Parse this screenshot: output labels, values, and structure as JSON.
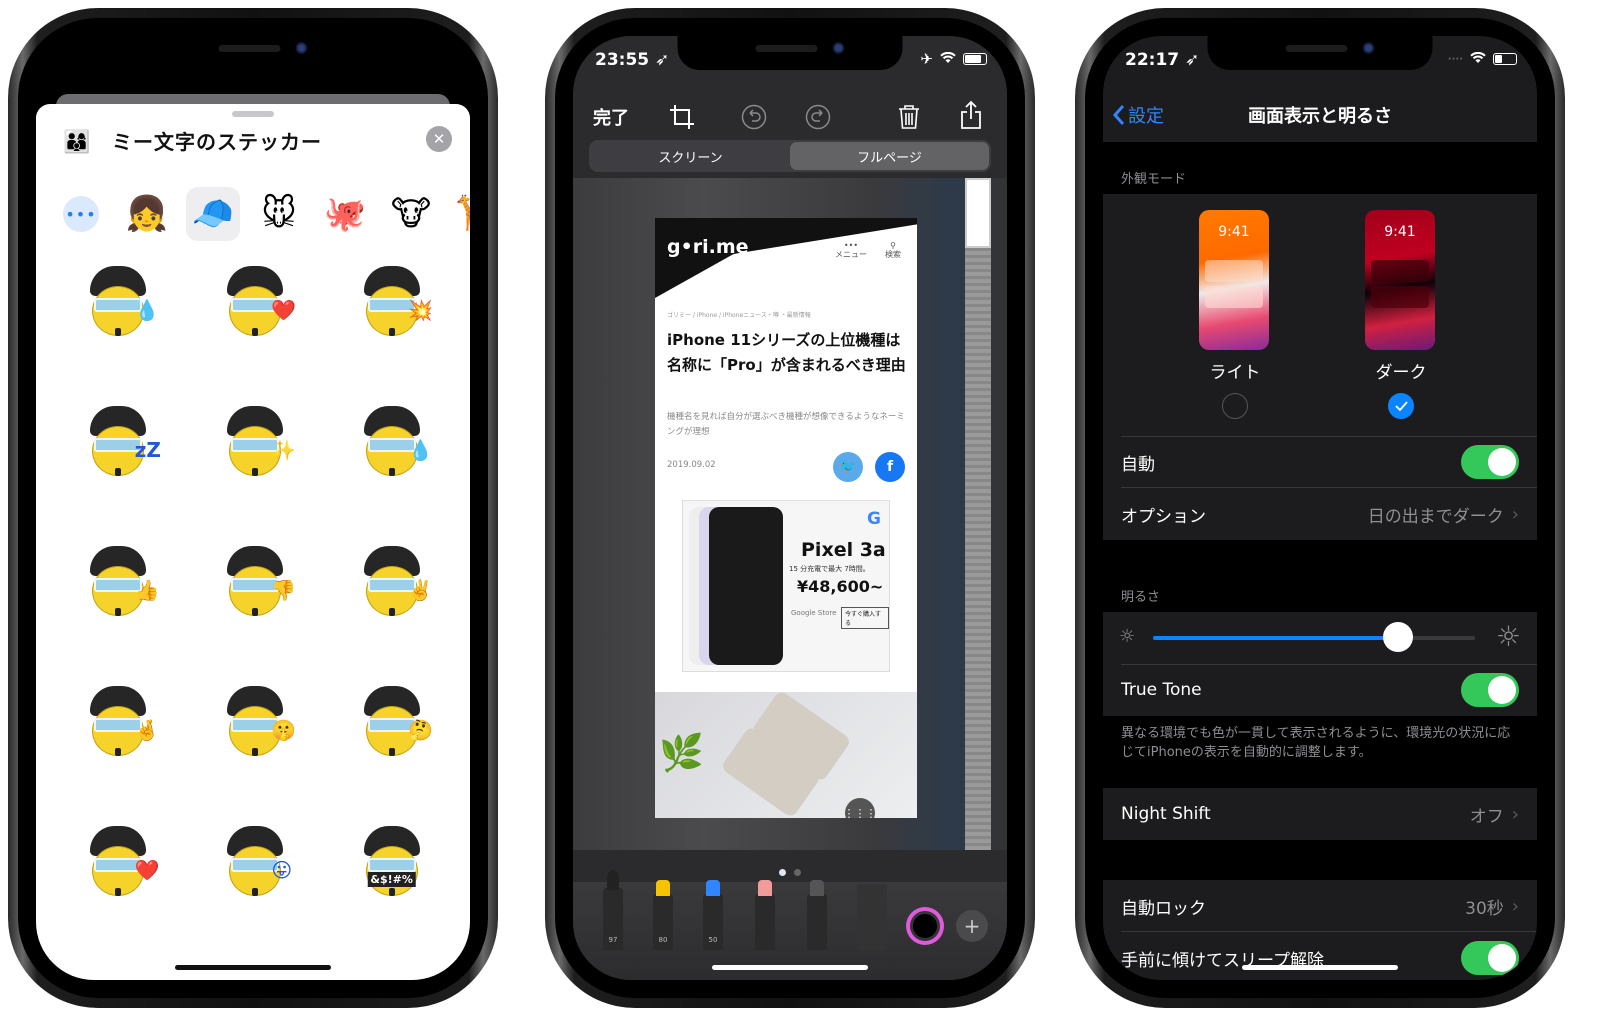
{
  "phone1": {
    "sheet_title": "ミー文字のステッカー",
    "close_label": "✕",
    "more_label": "•••",
    "characters": [
      {
        "name": "memoji-girl",
        "glyph": "👧"
      },
      {
        "name": "memoji-me",
        "glyph": "🧢",
        "selected": true
      },
      {
        "name": "mouse",
        "glyph": "🐭"
      },
      {
        "name": "octopus",
        "glyph": "🐙"
      },
      {
        "name": "cow",
        "glyph": "🐮"
      },
      {
        "name": "giraffe",
        "glyph": "🦒"
      }
    ],
    "stickers": [
      {
        "name": "tears-of-joy",
        "extra": "💧"
      },
      {
        "name": "heart-eyes",
        "extra": "❤️"
      },
      {
        "name": "mind-blown",
        "extra": "💥"
      },
      {
        "name": "sleeping",
        "extra": "zZ"
      },
      {
        "name": "star-struck",
        "extra": "✨"
      },
      {
        "name": "crying",
        "extra": "💧"
      },
      {
        "name": "thumbs-up",
        "extra": "👍"
      },
      {
        "name": "thumbs-down",
        "extra": "👎"
      },
      {
        "name": "peace",
        "extra": "✌️"
      },
      {
        "name": "fingers-crossed",
        "extra": "🤞"
      },
      {
        "name": "shush",
        "extra": "🤫"
      },
      {
        "name": "thinking",
        "extra": "🤔"
      },
      {
        "name": "kiss",
        "extra": "❤️"
      },
      {
        "name": "tongue-out",
        "extra": "😛"
      },
      {
        "name": "cursing",
        "extra": "",
        "text": "&$!#%"
      }
    ]
  },
  "phone2": {
    "status_time": "23:55 ➶",
    "status_icons": [
      "✈",
      "wifi"
    ],
    "done_label": "完了",
    "tabs": [
      {
        "label": "スクリーン",
        "active": false
      },
      {
        "label": "フルページ",
        "active": true
      }
    ],
    "webpage": {
      "logo": "g•ri.me",
      "menu_label": "メニュー",
      "search_label": "検索",
      "breadcrumb": "ゴリミー / iPhone / iPhoneニュース・噂 ・最新情報",
      "title": "iPhone 11シリーズの上位機種は名称に「Pro」が含まれるべき理由",
      "subtitle": "機種名を見れば自分が選ぶべき機種が想像できるようなネーミングが理想",
      "date": "2019.09.02",
      "ad": {
        "product": "Pixel 3a",
        "note": "15 分充電で最大 7時間。",
        "price": "¥48,600~",
        "store": "Google Store",
        "buy_label": "今すぐ購入する",
        "brand": "G"
      }
    },
    "tools": [
      {
        "name": "pen",
        "number": "97",
        "tip": "#222"
      },
      {
        "name": "marker",
        "number": "80",
        "tip": "#f5c400"
      },
      {
        "name": "pencil",
        "number": "50",
        "tip": "#2f86ff"
      },
      {
        "name": "eraser",
        "number": "",
        "tip": "#f19b9b"
      },
      {
        "name": "lasso",
        "number": "",
        "tip": "#555"
      },
      {
        "name": "ruler",
        "number": "",
        "tip": "#333"
      }
    ],
    "page_dots": {
      "count": 2,
      "active": 0
    }
  },
  "phone3": {
    "status_time": "22:17 ➶",
    "back_label": "設定",
    "nav_title": "画面表示と明るさ",
    "appearance_header": "外観モード",
    "modes": [
      {
        "label": "ライト",
        "time": "9:41",
        "selected": false
      },
      {
        "label": "ダーク",
        "time": "9:41",
        "selected": true
      }
    ],
    "automatic_label": "自動",
    "automatic_on": true,
    "options_label": "オプション",
    "options_value": "日の出までダーク",
    "brightness_header": "明るさ",
    "brightness_level": 0.76,
    "true_tone_label": "True Tone",
    "true_tone_on": true,
    "true_tone_footer": "異なる環境でも色が一貫して表示されるように、環境光の状況に応じてiPhoneの表示を自動的に調整します。",
    "night_shift_label": "Night Shift",
    "night_shift_value": "オフ",
    "auto_lock_label": "自動ロック",
    "auto_lock_value": "30秒",
    "raise_to_wake_label": "手前に傾けてスリープ解除",
    "raise_to_wake_on": true,
    "accent": "#0a84ff",
    "toggle_color": "#34c759"
  }
}
